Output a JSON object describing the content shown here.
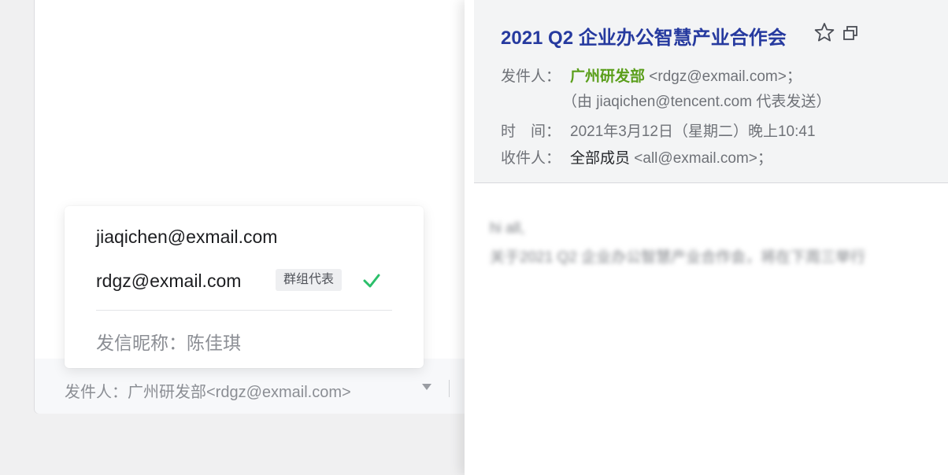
{
  "compose": {
    "sender_label": "发件人：",
    "sender_value": "广州研发部<rdgz@exmail.com>",
    "popup": {
      "accounts": [
        {
          "address": "jiaqichen@exmail.com"
        },
        {
          "address": "rdgz@exmail.com",
          "badge": "群组代表",
          "selected": true
        }
      ],
      "nickname_label": "发信昵称：",
      "nickname_value": "陈佳琪"
    }
  },
  "mail": {
    "subject": "2021 Q2 企业办公智慧产业合作会",
    "from_label": "发件人：",
    "from_name": "广州研发部",
    "from_address": "<rdgz@exmail.com>；",
    "on_behalf": "（由 jiaqichen@tencent.com 代表发送）",
    "time_label": "时　间：",
    "time_value": "2021年3月12日（星期二）晚上10:41",
    "to_label": "收件人：",
    "to_name": "全部成员",
    "to_address": "<all@exmail.com>；",
    "body_line1": "hi all,",
    "body_line2": "关于2021 Q2 企业办公智慧产业合作会，将在下周三举行"
  },
  "colors": {
    "subject": "#263a9f",
    "sender_name": "#5a9e1a",
    "check": "#2bbf6a"
  },
  "icons": [
    "check-icon",
    "star-icon",
    "window-icon",
    "caret-down-icon"
  ]
}
